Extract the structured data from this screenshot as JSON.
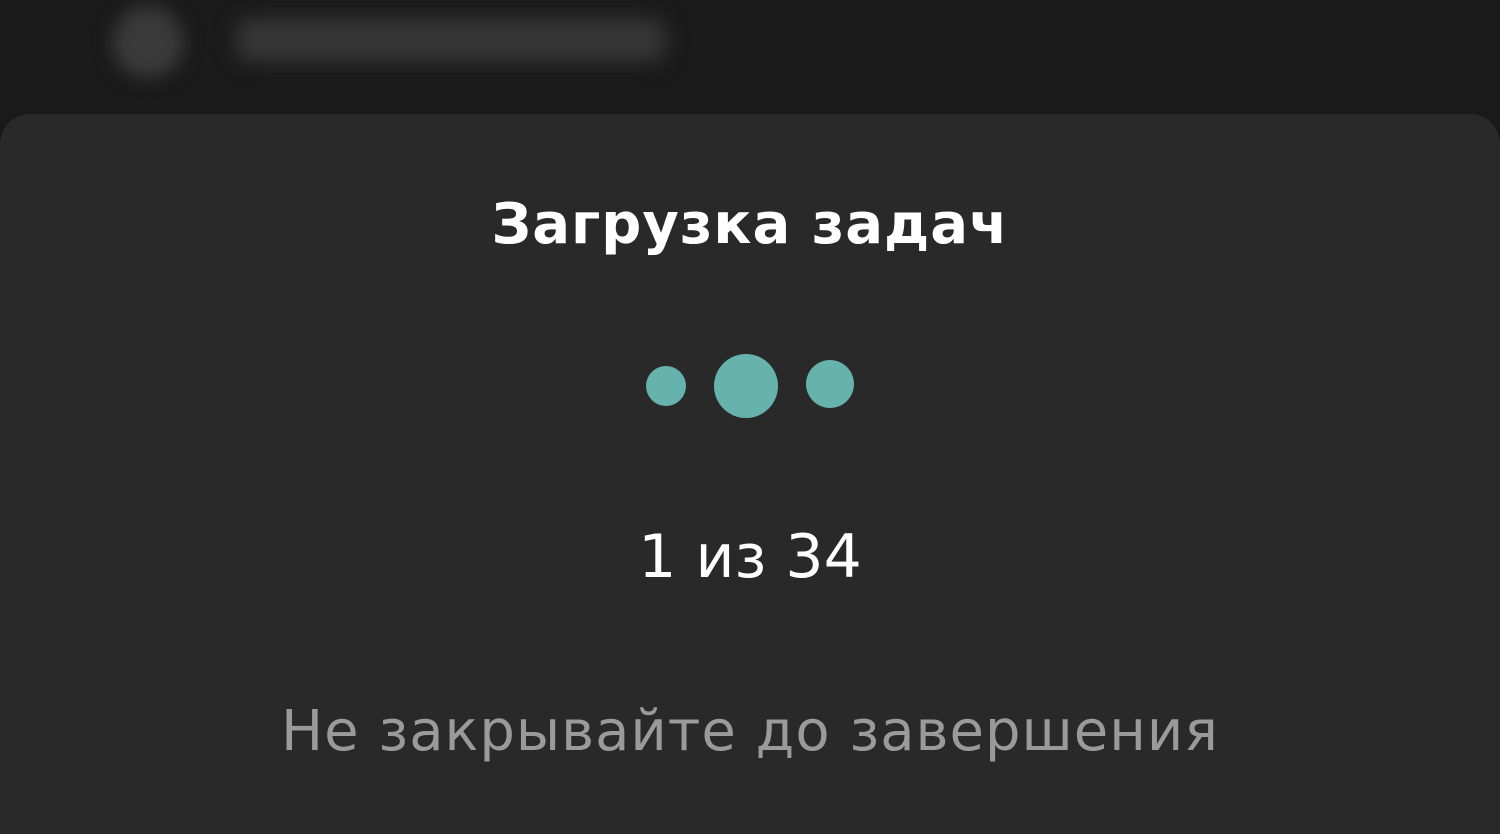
{
  "background_header": {
    "icon": "app-icon"
  },
  "loading_sheet": {
    "title": "Загрузка задач",
    "progress_text": "1 из 34",
    "progress": {
      "current": 1,
      "total": 34
    },
    "hint": "Не закрывайте до завершения",
    "loader_icon": "loading-dots-icon"
  },
  "colors": {
    "accent": "#66b3ae",
    "sheet_background": "#292929",
    "title_text": "#ffffff",
    "hint_text": "#9a9a9a"
  }
}
